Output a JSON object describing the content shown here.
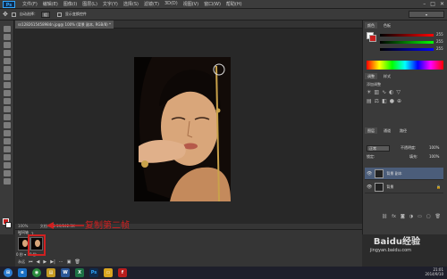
{
  "menubar": {
    "logo": "Ps",
    "items": [
      "文件(F)",
      "编辑(E)",
      "图像(I)",
      "图层(L)",
      "文字(Y)",
      "选择(S)",
      "滤镜(T)",
      "3D(D)",
      "视图(V)",
      "窗口(W)",
      "帮助(H)"
    ]
  },
  "optionsbar": {
    "auto_select": "自动选择：",
    "group": "组",
    "show_transform": "显示变换控件"
  },
  "document": {
    "tab_label": "ss1282615458984n.jpg@ 100% (背景 副本, RGB/8) *",
    "zoom": "100%",
    "doc_size": "文档:421.1K/842.3K"
  },
  "timeline": {
    "title": "时间轴",
    "frames": [
      {
        "label": "1",
        "delay": "0 秒 ▾"
      },
      {
        "label": "2",
        "delay": "0 秒 ▾"
      }
    ],
    "loop": "永远",
    "annotation": "复制第二帧"
  },
  "right_panels": {
    "color_tabs": [
      "颜色",
      "色板"
    ],
    "rgb": {
      "r": "255",
      "g": "255",
      "b": "255"
    },
    "adjust_tabs": [
      "调整",
      "样式"
    ],
    "adjust_title": "添加调整",
    "layers_tabs": [
      "图层",
      "通道",
      "路径"
    ],
    "blend_mode": "正常",
    "opacity_label": "不透明度:",
    "opacity": "100%",
    "lock_label": "锁定:",
    "fill_label": "填充:",
    "fill": "100%",
    "layers": [
      {
        "name": "背景 副本"
      },
      {
        "name": "背景"
      }
    ]
  },
  "taskbar": {
    "icons": [
      "start",
      "ie",
      "chrome",
      "explorer",
      "word",
      "excel",
      "photoshop",
      "folder",
      "flash"
    ],
    "time": "21:01",
    "date": "2014/9/10"
  },
  "watermark": {
    "brand": "Baidu经验",
    "url": "jingyan.baidu.com"
  },
  "colors": {
    "annotation_red": "#d02020",
    "foreground": "#c81e1e",
    "background": "#ffffff"
  }
}
